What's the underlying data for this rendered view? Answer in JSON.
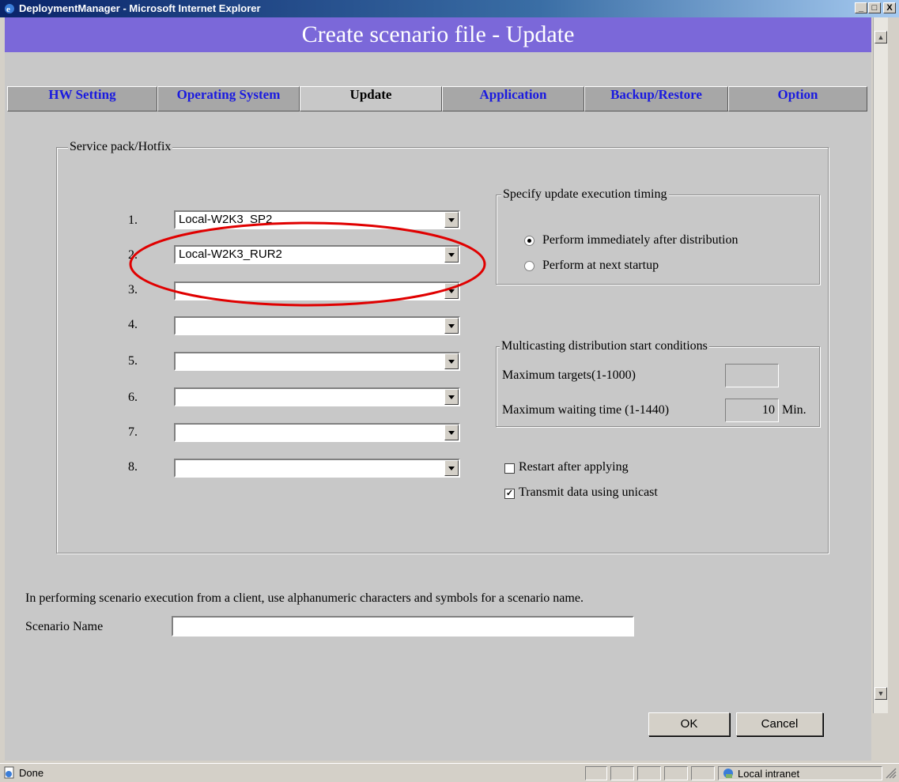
{
  "window": {
    "title": "DeploymentManager - Microsoft Internet Explorer",
    "controls": [
      "_",
      "□",
      "X"
    ]
  },
  "page": {
    "header": "Create scenario file - Update"
  },
  "tabs": [
    {
      "label": "HW Setting",
      "active": false
    },
    {
      "label": "Operating System",
      "active": false
    },
    {
      "label": "Update",
      "active": true
    },
    {
      "label": "Application",
      "active": false
    },
    {
      "label": "Backup/Restore",
      "active": false
    },
    {
      "label": "Option",
      "active": false
    }
  ],
  "service_pack": {
    "legend": "Service pack/Hotfix",
    "rows": [
      {
        "num": "1.",
        "value": "Local-W2K3_SP2"
      },
      {
        "num": "2.",
        "value": "Local-W2K3_RUR2"
      },
      {
        "num": "3.",
        "value": ""
      },
      {
        "num": "4.",
        "value": ""
      },
      {
        "num": "5.",
        "value": ""
      },
      {
        "num": "6.",
        "value": ""
      },
      {
        "num": "7.",
        "value": ""
      },
      {
        "num": "8.",
        "value": ""
      }
    ]
  },
  "timing": {
    "legend": "Specify update execution timing",
    "options": [
      {
        "label": "Perform immediately after distribution",
        "selected": true
      },
      {
        "label": "Perform at next startup",
        "selected": false
      }
    ]
  },
  "multicast": {
    "legend": "Multicasting distribution start conditions",
    "max_targets_label": "Maximum targets(1-1000)",
    "max_targets_value": "",
    "max_wait_label": "Maximum waiting time (1-1440)",
    "max_wait_value": "10",
    "max_wait_unit": "Min."
  },
  "checkboxes": [
    {
      "label": "Restart after applying",
      "checked": false,
      "mark": ""
    },
    {
      "label": "Transmit data using unicast",
      "checked": true,
      "mark": "✓"
    }
  ],
  "note": "In performing scenario execution from a client, use alphanumeric characters and symbols for a scenario name.",
  "scenario_name": {
    "label": "Scenario Name",
    "value": ""
  },
  "buttons": {
    "ok": "OK",
    "cancel": "Cancel"
  },
  "statusbar": {
    "status": "Done",
    "zone": "Local intranet"
  },
  "colors": {
    "header_bg": "#7b68d9",
    "tab_link": "#1a1ae0",
    "annotation": "#e00000"
  }
}
